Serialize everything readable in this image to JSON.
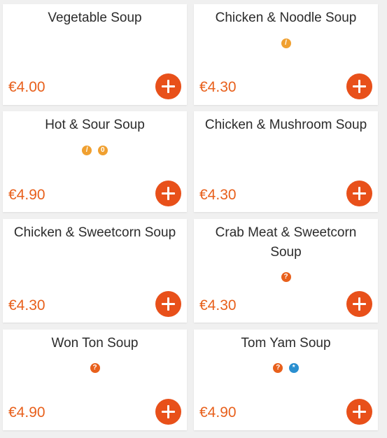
{
  "colors": {
    "accent": "#e8501a",
    "price": "#e8601c",
    "icon_orange": "#f0a030",
    "icon_blue": "#2a8fd0"
  },
  "items": [
    {
      "name": "Vegetable Soup",
      "price": "€4.00",
      "icons": []
    },
    {
      "name": "Chicken & Noodle Soup",
      "price": "€4.30",
      "icons": [
        "gluten-icon"
      ]
    },
    {
      "name": "Hot & Sour Soup",
      "price": "€4.90",
      "icons": [
        "gluten-icon",
        "egg-icon"
      ]
    },
    {
      "name": "Chicken & Mushroom Soup",
      "price": "€4.30",
      "icons": []
    },
    {
      "name": "Chicken & Sweetcorn Soup",
      "price": "€4.30",
      "icons": []
    },
    {
      "name": "Crab Meat & Sweetcorn Soup",
      "price": "€4.30",
      "icons": [
        "crustacean-icon"
      ]
    },
    {
      "name": "Won Ton Soup",
      "price": "€4.90",
      "icons": [
        "crustacean-icon"
      ]
    },
    {
      "name": "Tom Yam Soup",
      "price": "€4.90",
      "icons": [
        "crustacean-icon",
        "fish-icon"
      ]
    }
  ]
}
